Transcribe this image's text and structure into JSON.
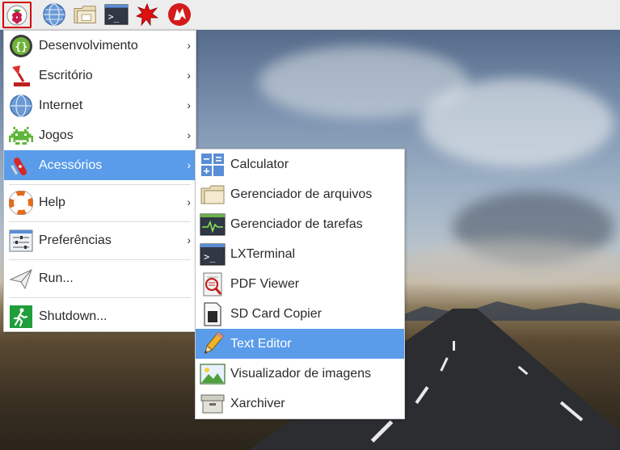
{
  "panel": {
    "launchers": [
      {
        "icon": "raspberry-menu-icon"
      },
      {
        "icon": "globe-browser-icon"
      },
      {
        "icon": "folder-icon"
      },
      {
        "icon": "terminal-icon"
      },
      {
        "icon": "mathematica-spikey-icon"
      },
      {
        "icon": "wolfram-icon"
      }
    ],
    "terminal_glyph": ">_"
  },
  "main_menu": {
    "items": [
      {
        "label": "Desenvolvimento",
        "icon": "braces-dev-icon",
        "has_submenu": true
      },
      {
        "label": "Escritório",
        "icon": "desk-lamp-icon",
        "has_submenu": true
      },
      {
        "label": "Internet",
        "icon": "globe-icon",
        "has_submenu": true
      },
      {
        "label": "Jogos",
        "icon": "space-invader-icon",
        "has_submenu": true
      },
      {
        "label": "Acessórios",
        "icon": "swiss-knife-icon",
        "has_submenu": true,
        "active": true
      },
      {
        "label": "Help",
        "icon": "lifebuoy-icon",
        "has_submenu": true
      },
      {
        "label": "Preferências",
        "icon": "preferences-sliders-icon",
        "has_submenu": true
      },
      {
        "label": "Run...",
        "icon": "paper-plane-icon",
        "has_submenu": false
      },
      {
        "label": "Shutdown...",
        "icon": "exit-running-man-icon",
        "has_submenu": false
      }
    ],
    "arrow": "›"
  },
  "sub_menu": {
    "items": [
      {
        "label": "Calculator",
        "icon": "calculator-icon"
      },
      {
        "label": "Gerenciador de arquivos",
        "icon": "folder-icon"
      },
      {
        "label": "Gerenciador de tarefas",
        "icon": "task-monitor-icon"
      },
      {
        "label": "LXTerminal",
        "icon": "terminal-icon"
      },
      {
        "label": "PDF Viewer",
        "icon": "pdf-magnifier-icon"
      },
      {
        "label": "SD Card Copier",
        "icon": "sd-card-icon"
      },
      {
        "label": "Text Editor",
        "icon": "pencil-icon",
        "active": true
      },
      {
        "label": "Visualizador de imagens",
        "icon": "image-viewer-icon"
      },
      {
        "label": "Xarchiver",
        "icon": "archive-box-icon"
      }
    ]
  },
  "colors": {
    "highlight": "#5a9cea",
    "panel_bg": "#ededed",
    "launcher_outline": "#d20000"
  }
}
